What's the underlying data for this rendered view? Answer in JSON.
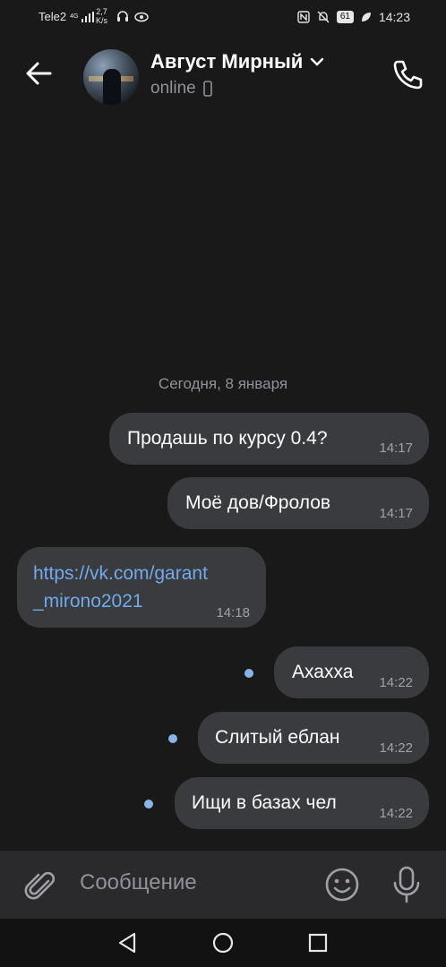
{
  "status_bar": {
    "carrier": "Tele2",
    "network_type": "4G",
    "speed_value": "2,7",
    "speed_unit": "K/s",
    "battery": "61",
    "time": "14:23",
    "icons_left": [
      "signal-icon",
      "headset-icon",
      "eye-icon"
    ],
    "icons_right": [
      "nfc-icon",
      "mute-bell-icon",
      "battery-icon",
      "leaf-icon"
    ]
  },
  "header": {
    "contact_name": "Август Мирный",
    "presence": "online"
  },
  "chat": {
    "date_separator": "Сегодня, 8 января",
    "messages": [
      {
        "side": "out",
        "text": "Продашь по курсу 0.4?",
        "time": "14:17",
        "unread": false
      },
      {
        "side": "out",
        "text": "Моё дов/Фролов",
        "time": "14:17",
        "unread": false
      },
      {
        "side": "in",
        "text_line1": "https://vk.com/garant",
        "text_line2": "_mirono2021",
        "time": "14:18",
        "is_link": true
      },
      {
        "side": "out",
        "text": "Ахахха",
        "time": "14:22",
        "unread": true
      },
      {
        "side": "out",
        "text": "Слитый еблан",
        "time": "14:22",
        "unread": true
      },
      {
        "side": "out",
        "text": "Ищи в базах чел",
        "time": "14:22",
        "unread": true
      }
    ]
  },
  "composer": {
    "placeholder": "Сообщение"
  },
  "colors": {
    "background": "#19191a",
    "bubble": "#3a3b3e",
    "link": "#71aaeb",
    "unread_dot": "#8bb4e6",
    "secondary_text": "#8f9299"
  }
}
